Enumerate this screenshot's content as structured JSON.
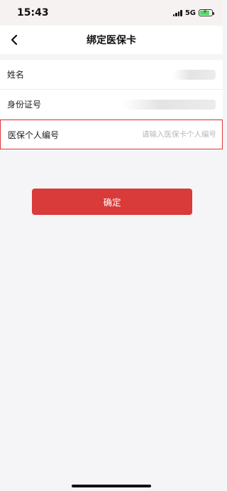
{
  "status_bar": {
    "time": "15:43",
    "network": "5G",
    "battery_level": 0.8
  },
  "nav": {
    "back_icon": "chevron-left-icon",
    "title": "绑定医保卡"
  },
  "form": {
    "name_label": "姓名",
    "id_label": "身份证号",
    "insurance_label": "医保个人编号",
    "insurance_value": "",
    "insurance_placeholder": "请输入医保卡个人编号"
  },
  "actions": {
    "confirm_label": "确定"
  },
  "colors": {
    "accent": "#d93a3a",
    "input_border": "#e0373b",
    "background": "#f5f5f7"
  }
}
